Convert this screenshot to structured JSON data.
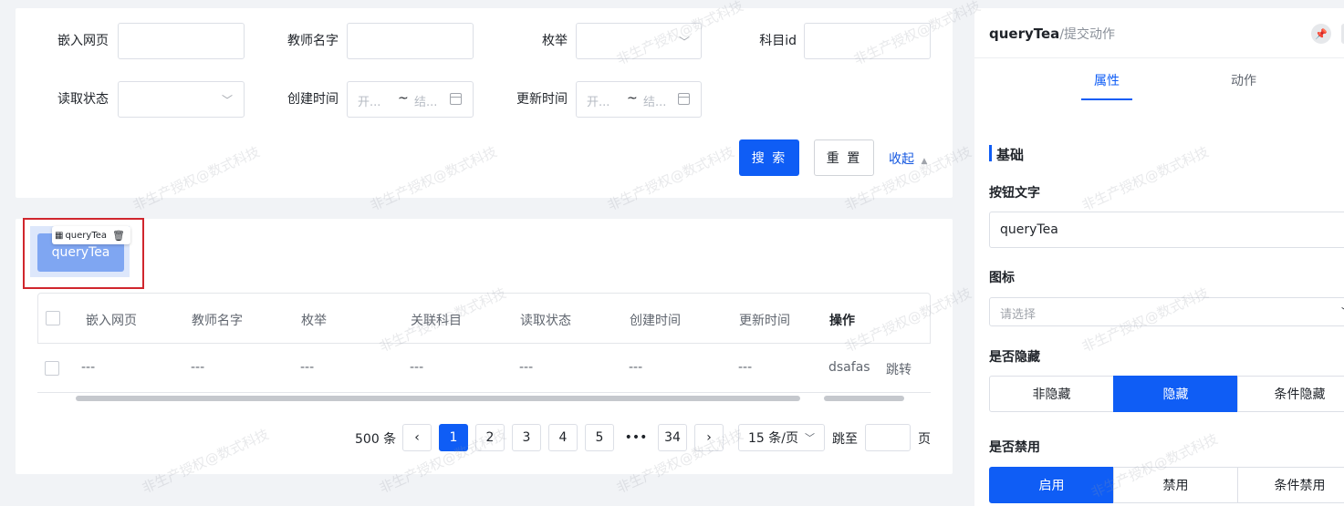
{
  "search_form": {
    "fields": [
      {
        "label": "嵌入网页",
        "value": ""
      },
      {
        "label": "教师名字",
        "value": ""
      },
      {
        "label": "枚举",
        "value": ""
      },
      {
        "label": "科目id",
        "value": ""
      },
      {
        "label": "读取状态",
        "value": ""
      },
      {
        "label": "创建时间",
        "start_placeholder": "开...",
        "end_placeholder": "结...",
        "separator": "~"
      },
      {
        "label": "更新时间",
        "start_placeholder": "开...",
        "end_placeholder": "结...",
        "separator": "~"
      }
    ],
    "search_button": "搜 索",
    "reset_button": "重 置",
    "collapse_link": "收起"
  },
  "component": {
    "button_label": "queryTea",
    "toolbar_label": "queryTea"
  },
  "table": {
    "columns": [
      "嵌入网页",
      "教师名字",
      "枚举",
      "关联科目",
      "读取状态",
      "创建时间",
      "更新时间",
      "操作"
    ],
    "rows": [
      {
        "cells": [
          "---",
          "---",
          "---",
          "---",
          "---",
          "---",
          "---"
        ],
        "actions": [
          "dsafas",
          "跳转"
        ]
      }
    ]
  },
  "pagination": {
    "total": "500 条",
    "pages": [
      "1",
      "2",
      "3",
      "4",
      "5",
      "•••",
      "34"
    ],
    "current": "1",
    "page_size": "15 条/页",
    "jump_label": "跳至",
    "page_suffix": "页"
  },
  "panel": {
    "title": "queryTea",
    "subtitle": "/提交动作",
    "tabs": [
      "属性",
      "动作"
    ],
    "active_tab": "属性",
    "section": "基础",
    "button_text_label": "按钮文字",
    "button_text_value": "queryTea",
    "icon_label": "图标",
    "icon_placeholder": "请选择",
    "hidden_label": "是否隐藏",
    "hidden_options": [
      "非隐藏",
      "隐藏",
      "条件隐藏"
    ],
    "hidden_selected": "隐藏",
    "disabled_label": "是否禁用",
    "disabled_options": [
      "启用",
      "禁用",
      "条件禁用"
    ],
    "disabled_selected": "启用"
  },
  "watermark": "非生产授权@数式科技",
  "colors": {
    "primary": "#0f5df5",
    "selection_border": "#d0262d",
    "link": "#1457e0"
  }
}
